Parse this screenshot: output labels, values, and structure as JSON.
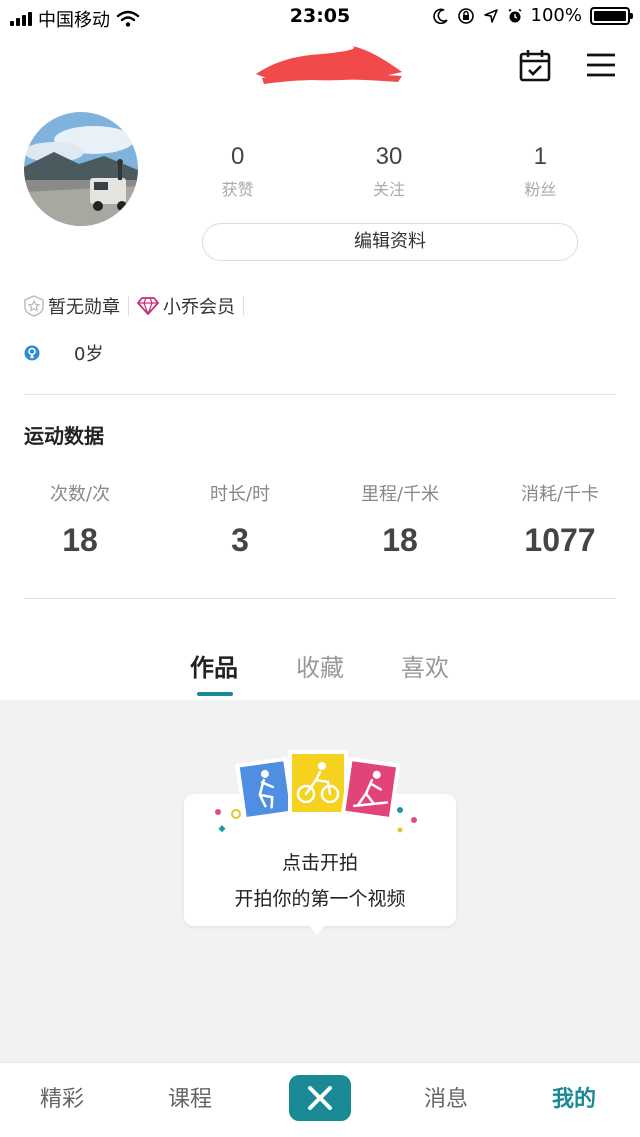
{
  "status_bar": {
    "carrier": "中国移动",
    "time": "23:05",
    "battery_percent": "100%",
    "icons": [
      "signal-icon",
      "wifi-icon",
      "moon-icon",
      "rotation-lock-icon",
      "location-icon",
      "alarm-icon",
      "battery-icon"
    ]
  },
  "header": {
    "icons": [
      "calendar-icon",
      "menu-icon"
    ]
  },
  "profile": {
    "stats": [
      {
        "value": "0",
        "label": "获赞"
      },
      {
        "value": "30",
        "label": "关注"
      },
      {
        "value": "1",
        "label": "粉丝"
      }
    ],
    "edit_label": "编辑资料",
    "badges": [
      {
        "label": "暂无勋章",
        "icon": "medal-icon"
      },
      {
        "label": "小乔会员",
        "icon": "diamond-icon"
      }
    ],
    "age": "0岁"
  },
  "sport": {
    "title": "运动数据",
    "stats": [
      {
        "label": "次数/次",
        "value": "18"
      },
      {
        "label": "时长/时",
        "value": "3"
      },
      {
        "label": "里程/千米",
        "value": "18"
      },
      {
        "label": "消耗/千卡",
        "value": "1077"
      }
    ]
  },
  "tabs": [
    {
      "label": "作品",
      "active": true
    },
    {
      "label": "收藏",
      "active": false
    },
    {
      "label": "喜欢",
      "active": false
    }
  ],
  "empty_prompt": {
    "line1": "点击开拍",
    "line2": "开拍你的第一个视频"
  },
  "bottom_nav": [
    {
      "label": "精彩",
      "active": false
    },
    {
      "label": "课程",
      "active": false
    },
    {
      "label": "X",
      "active": false
    },
    {
      "label": "消息",
      "active": false
    },
    {
      "label": "我的",
      "active": true
    }
  ],
  "colors": {
    "accent": "#1a8a96",
    "redaction": "#f04a4a",
    "content_bg": "#f2f2f2"
  }
}
